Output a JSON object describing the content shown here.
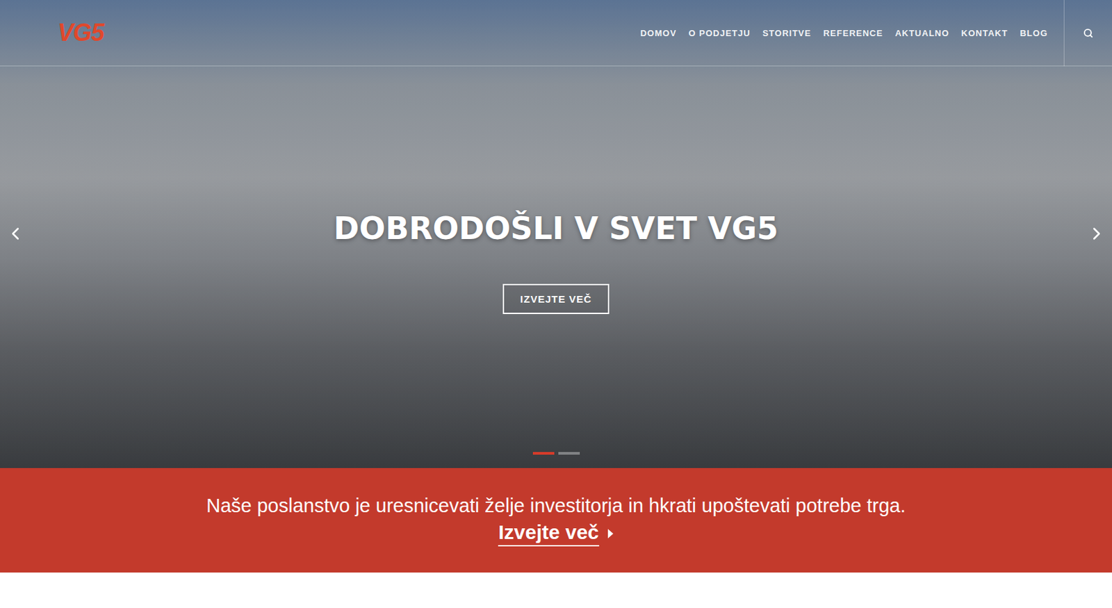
{
  "logo": "VG5",
  "nav": [
    {
      "label": "DOMOV"
    },
    {
      "label": "O PODJETJU"
    },
    {
      "label": "STORITVE"
    },
    {
      "label": "REFERENCE"
    },
    {
      "label": "AKTUALNO"
    },
    {
      "label": "KONTAKT"
    },
    {
      "label": "BLOG"
    }
  ],
  "hero": {
    "title": "DOBRODOŠLI V SVET VG5",
    "button": "IZVEJTE VEČ",
    "slides": [
      {
        "selected": true
      },
      {
        "selected": false
      }
    ]
  },
  "band": {
    "text": "Naše poslanstvo je uresnicevati želje investitorja in hkrati upoštevati potrebe trga.",
    "link": "Izvejte več"
  }
}
